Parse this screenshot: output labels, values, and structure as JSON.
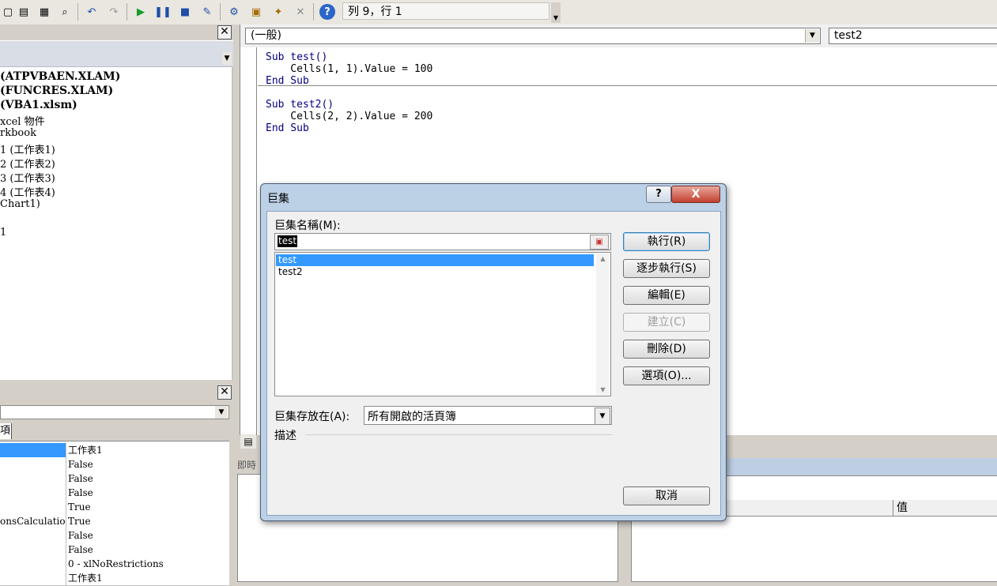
{
  "toolbar": {
    "status": "列 9，行 1",
    "icons": [
      "copy-icon",
      "paste-icon",
      "find-icon",
      "undo-icon",
      "redo-icon",
      "run-icon",
      "pause-icon",
      "reset-icon",
      "design-mode-icon",
      "project-explorer-icon",
      "properties-icon",
      "object-browser-icon",
      "toolbox-icon",
      "help-icon"
    ]
  },
  "project": {
    "items": [
      "(ATPVBAEN.XLAM)",
      "(FUNCRES.XLAM)",
      "(VBA1.xlsm)",
      "xcel 物件",
      "rkbook",
      "1 (工作表1)",
      "2 (工作表2)",
      "3 (工作表3)",
      "4 (工作表4)",
      "Chart1)",
      "",
      "1"
    ]
  },
  "properties": {
    "tab": "項",
    "rows": [
      {
        "name": "",
        "value": "工作表1"
      },
      {
        "name": "",
        "value": "False"
      },
      {
        "name": "",
        "value": "False"
      },
      {
        "name": "",
        "value": "False"
      },
      {
        "name": "",
        "value": "True"
      },
      {
        "name": "onsCalculation",
        "value": "True"
      },
      {
        "name": "",
        "value": "False"
      },
      {
        "name": "",
        "value": "False"
      },
      {
        "name": "",
        "value": "0 - xlNoRestrictions"
      },
      {
        "name": "",
        "value": "工作表1"
      }
    ]
  },
  "code": {
    "object_combo": "(一般)",
    "proc_combo": "test2",
    "lines": [
      "Sub test()",
      "    Cells(1, 1).Value = 100",
      "End Sub",
      "",
      "Sub test2()",
      "    Cells(2, 2).Value = 200",
      "End Sub"
    ]
  },
  "immediate": {
    "title": "即時"
  },
  "locals": {
    "value_header": "值"
  },
  "dialog": {
    "title": "巨集",
    "help_glyph": "?",
    "close_glyph": "X",
    "name_label": "巨集名稱(M):",
    "name_value": "test",
    "macros": [
      "test",
      "test2"
    ],
    "selected_index": 0,
    "location_label": "巨集存放在(A):",
    "location_value": "所有開啟的活頁簿",
    "description_label": "描述",
    "buttons": {
      "run": "執行(R)",
      "step_into": "逐步執行(S)",
      "edit": "編輯(E)",
      "create": "建立(C)",
      "delete": "刪除(D)",
      "options": "選項(O)...",
      "cancel": "取消"
    }
  },
  "colors": {
    "selection": "#3399ff",
    "code_keyword": "#00007f",
    "dialog_frame": "#bcd0e6"
  }
}
